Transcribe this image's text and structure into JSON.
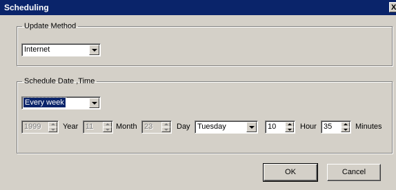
{
  "window": {
    "title": "Scheduling",
    "close_glyph": "X"
  },
  "update_method": {
    "legend": "Update Method",
    "value": "Internet"
  },
  "schedule": {
    "legend": "Schedule Date ,Time",
    "frequency": "Every week",
    "year_value": "1999",
    "year_label": "Year",
    "month_value": "11",
    "month_label": "Month",
    "day_value": "23",
    "day_label": "Day",
    "weekday": "Tuesday",
    "hour_value": "10",
    "hour_label": "Hour",
    "minute_value": "35",
    "minute_label": "Minutes"
  },
  "buttons": {
    "ok": "OK",
    "cancel": "Cancel"
  }
}
